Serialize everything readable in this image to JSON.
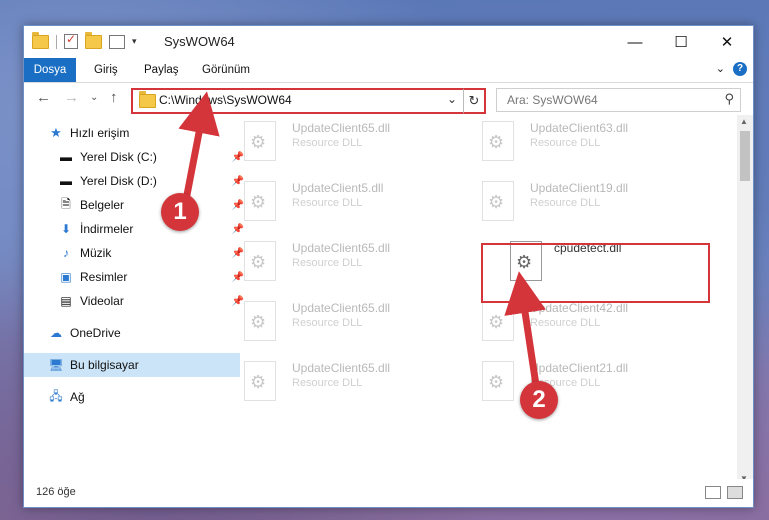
{
  "window": {
    "title": "SysWOW64"
  },
  "ribbon": {
    "tabs": [
      "Dosya",
      "Giriş",
      "Paylaş",
      "Görünüm"
    ]
  },
  "address": {
    "path": "C:\\Windows\\SysWOW64"
  },
  "search": {
    "placeholder": "Ara: SysWOW64"
  },
  "nav_pane": {
    "items": [
      {
        "label": "Hızlı erişim",
        "icon": "star-icon"
      },
      {
        "label": "Yerel Disk (C:)",
        "icon": "drive-icon",
        "pinned": true
      },
      {
        "label": "Yerel Disk (D:)",
        "icon": "drive-icon",
        "pinned": true
      },
      {
        "label": "Belgeler",
        "icon": "documents-icon",
        "pinned": true
      },
      {
        "label": "İndirmeler",
        "icon": "download-icon",
        "pinned": true
      },
      {
        "label": "Müzik",
        "icon": "music-icon",
        "pinned": true
      },
      {
        "label": "Resimler",
        "icon": "pictures-icon",
        "pinned": true
      },
      {
        "label": "Videolar",
        "icon": "videos-icon",
        "pinned": true
      },
      {
        "label": "OneDrive",
        "icon": "cloud-icon"
      },
      {
        "label": "Bu bilgisayar",
        "icon": "computer-icon",
        "selected": true
      },
      {
        "label": "Ağ",
        "icon": "network-icon"
      }
    ]
  },
  "files": [
    {
      "name": "UpdateClient65.dll",
      "type": "Resource DLL"
    },
    {
      "name": "UpdateClient63.dll",
      "type": "Resource DLL"
    },
    {
      "name": "UpdateClient5.dll",
      "type": "Resource DLL"
    },
    {
      "name": "UpdateClient19.dll",
      "type": "Resource DLL"
    },
    {
      "name": "UpdateClient65.dll",
      "type": "Resource DLL"
    },
    {
      "name": "cpudetect.dll",
      "type": ""
    },
    {
      "name": "UpdateClient65.dll",
      "type": "Resource DLL"
    },
    {
      "name": "UpdateClient42.dll",
      "type": "Resource DLL"
    },
    {
      "name": "UpdateClient65.dll",
      "type": "Resource DLL"
    },
    {
      "name": "UpdateClient21.dll",
      "type": "Resource DLL"
    }
  ],
  "status": {
    "count": "126 öğe"
  },
  "annotations": {
    "step1": "1",
    "step2": "2"
  },
  "colors": {
    "accent": "#1a6fc4",
    "highlight": "#d4353b"
  }
}
